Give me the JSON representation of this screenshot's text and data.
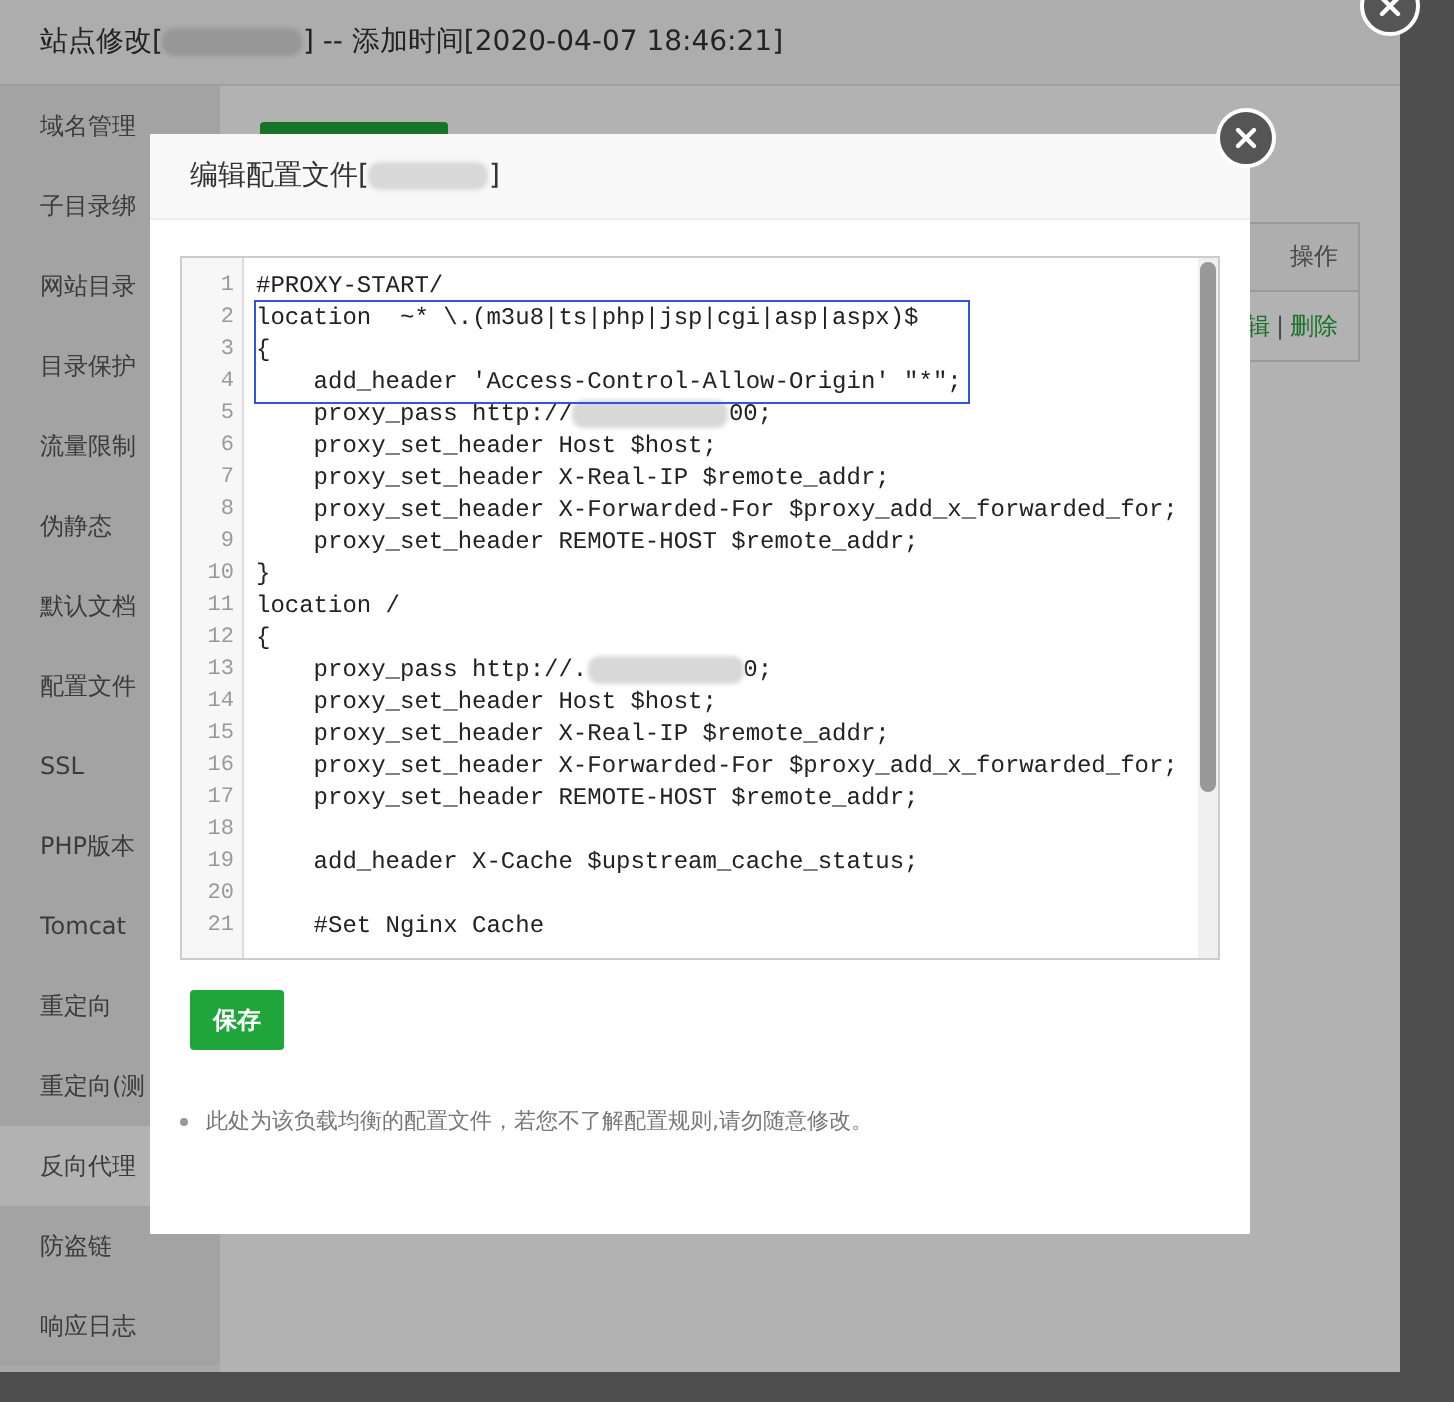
{
  "site_window": {
    "title_before": "站点修改[",
    "title_after": "] -- 添加时间[2020-04-07 18:46:21]"
  },
  "sidebar": {
    "items": [
      {
        "label": "域名管理",
        "selected": false
      },
      {
        "label": "子目录绑",
        "selected": false
      },
      {
        "label": "网站目录",
        "selected": false
      },
      {
        "label": "目录保护",
        "selected": false
      },
      {
        "label": "流量限制",
        "selected": false
      },
      {
        "label": "伪静态",
        "selected": false
      },
      {
        "label": "默认文档",
        "selected": false
      },
      {
        "label": "配置文件",
        "selected": false
      },
      {
        "label": "SSL",
        "selected": false
      },
      {
        "label": "PHP版本",
        "selected": false
      },
      {
        "label": "Tomcat",
        "selected": false
      },
      {
        "label": "重定向",
        "selected": false
      },
      {
        "label": "重定向(测",
        "selected": false
      },
      {
        "label": "反向代理",
        "selected": true
      },
      {
        "label": "防盗链",
        "selected": false
      },
      {
        "label": "响应日志",
        "selected": false
      }
    ]
  },
  "table": {
    "header": "操作",
    "actions": [
      "辑",
      "删除"
    ],
    "separator": "|"
  },
  "dialog": {
    "title_before": "编辑配置文件[",
    "title_after": "]",
    "lines": [
      {
        "number": "1",
        "text": "#PROXY-START/"
      },
      {
        "number": "2",
        "text": "location  ~* \\.(m3u8|ts|php|jsp|cgi|asp|aspx)$"
      },
      {
        "number": "3",
        "text": "{"
      },
      {
        "number": "4",
        "text": "    add_header 'Access-Control-Allow-Origin' \"*\";"
      },
      {
        "number": "5",
        "text": "    proxy_pass http://",
        "redacted": true,
        "after": "00;"
      },
      {
        "number": "6",
        "text": "    proxy_set_header Host $host;"
      },
      {
        "number": "7",
        "text": "    proxy_set_header X-Real-IP $remote_addr;"
      },
      {
        "number": "8",
        "text": "    proxy_set_header X-Forwarded-For $proxy_add_x_forwarded_for;"
      },
      {
        "number": "9",
        "text": "    proxy_set_header REMOTE-HOST $remote_addr;"
      },
      {
        "number": "10",
        "text": "}"
      },
      {
        "number": "11",
        "text": "location /"
      },
      {
        "number": "12",
        "text": "{"
      },
      {
        "number": "13",
        "text": "    proxy_pass http://.",
        "redacted": true,
        "after": "0;"
      },
      {
        "number": "14",
        "text": "    proxy_set_header Host $host;"
      },
      {
        "number": "15",
        "text": "    proxy_set_header X-Real-IP $remote_addr;"
      },
      {
        "number": "16",
        "text": "    proxy_set_header X-Forwarded-For $proxy_add_x_forwarded_for;"
      },
      {
        "number": "17",
        "text": "    proxy_set_header REMOTE-HOST $remote_addr;"
      },
      {
        "number": "18"
      },
      {
        "number": "19",
        "text": "    add_header X-Cache $upstream_cache_status;"
      },
      {
        "number": "20"
      },
      {
        "number": "21",
        "text": "    #Set Nginx Cache"
      }
    ],
    "save_button": "保存",
    "note": "此处为该负载均衡的配置文件，若您不了解配置规则,请勿随意修改。"
  }
}
